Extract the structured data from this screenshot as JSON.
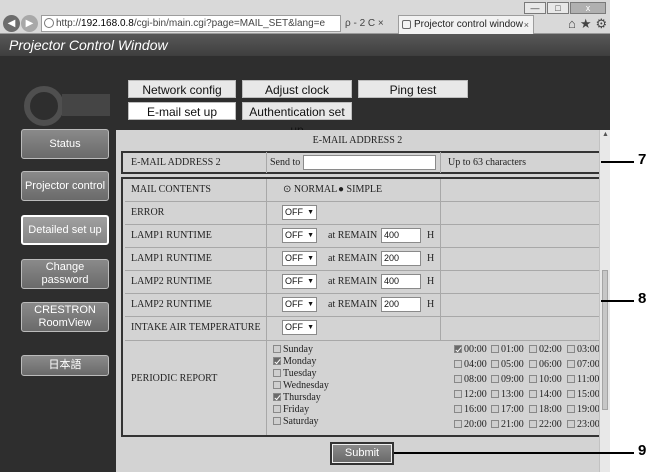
{
  "browser": {
    "url_prefix": "http://",
    "url_host": "192.168.0.8",
    "url_path": "/cgi-bin/main.cgi?page=MAIL_SET&lang=e",
    "url_tools": "ρ - 2 C ×",
    "tab_title": "Projector control window",
    "tab_close": "×",
    "win_min": "—",
    "win_max": "□",
    "win_close": "x",
    "toolbar_icons": "⌂★⚙"
  },
  "app": {
    "title": "Projector Control Window"
  },
  "sidebar": {
    "items": [
      {
        "label": "Status"
      },
      {
        "label": "Projector control"
      },
      {
        "label": "Detailed set up"
      },
      {
        "label": "Change password"
      },
      {
        "label": "CRESTRON RoomView"
      },
      {
        "label": "日本語"
      }
    ]
  },
  "tabs": {
    "row1": [
      "Network config",
      "Adjust clock",
      "Ping test"
    ],
    "row2": [
      "E-mail set up",
      "Authentication set up"
    ]
  },
  "section_title": "E-MAIL ADDRESS 2",
  "address": {
    "label": "E-MAIL ADDRESS 2",
    "send_to_label": "Send to",
    "value": "",
    "hint": "Up to 63 characters"
  },
  "mail_contents": {
    "label": "MAIL CONTENTS",
    "options": [
      "NORMAL",
      "SIMPLE"
    ],
    "selected": "SIMPLE"
  },
  "settings": [
    {
      "label": "ERROR",
      "value": "OFF",
      "remain_label": "",
      "remain": "",
      "unit": ""
    },
    {
      "label": "LAMP1 RUNTIME",
      "value": "OFF",
      "remain_label": "at REMAIN",
      "remain": "400",
      "unit": "H"
    },
    {
      "label": "LAMP1 RUNTIME",
      "value": "OFF",
      "remain_label": "at REMAIN",
      "remain": "200",
      "unit": "H"
    },
    {
      "label": "LAMP2 RUNTIME",
      "value": "OFF",
      "remain_label": "at REMAIN",
      "remain": "400",
      "unit": "H"
    },
    {
      "label": "LAMP2 RUNTIME",
      "value": "OFF",
      "remain_label": "at REMAIN",
      "remain": "200",
      "unit": "H"
    },
    {
      "label": "INTAKE AIR TEMPERATURE",
      "value": "OFF",
      "remain_label": "",
      "remain": "",
      "unit": ""
    }
  ],
  "periodic": {
    "label": "PERIODIC REPORT",
    "days": [
      {
        "name": "Sunday",
        "checked": false
      },
      {
        "name": "Monday",
        "checked": true
      },
      {
        "name": "Tuesday",
        "checked": false
      },
      {
        "name": "Wednesday",
        "checked": false
      },
      {
        "name": "Thursday",
        "checked": true
      },
      {
        "name": "Friday",
        "checked": false
      },
      {
        "name": "Saturday",
        "checked": false
      }
    ],
    "hours": [
      {
        "t": "00:00",
        "checked": true
      },
      {
        "t": "01:00",
        "checked": false
      },
      {
        "t": "02:00",
        "checked": false
      },
      {
        "t": "03:00",
        "checked": false
      },
      {
        "t": "04:00",
        "checked": false
      },
      {
        "t": "05:00",
        "checked": false
      },
      {
        "t": "06:00",
        "checked": false
      },
      {
        "t": "07:00",
        "checked": false
      },
      {
        "t": "08:00",
        "checked": false
      },
      {
        "t": "09:00",
        "checked": false
      },
      {
        "t": "10:00",
        "checked": false
      },
      {
        "t": "11:00",
        "checked": false
      },
      {
        "t": "12:00",
        "checked": false
      },
      {
        "t": "13:00",
        "checked": false
      },
      {
        "t": "14:00",
        "checked": false
      },
      {
        "t": "15:00",
        "checked": false
      },
      {
        "t": "16:00",
        "checked": false
      },
      {
        "t": "17:00",
        "checked": false
      },
      {
        "t": "18:00",
        "checked": false
      },
      {
        "t": "19:00",
        "checked": false
      },
      {
        "t": "20:00",
        "checked": false
      },
      {
        "t": "21:00",
        "checked": false
      },
      {
        "t": "22:00",
        "checked": false
      },
      {
        "t": "23:00",
        "checked": false
      }
    ]
  },
  "submit_label": "Submit",
  "callouts": [
    "7",
    "8",
    "9"
  ]
}
